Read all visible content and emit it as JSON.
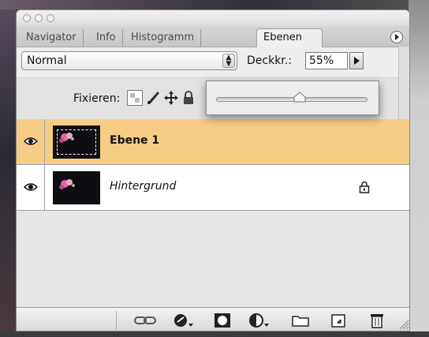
{
  "window": {
    "traffic_lights": [
      "close",
      "minimize",
      "zoom"
    ]
  },
  "tabs": [
    {
      "label": "Navigator",
      "active": false
    },
    {
      "label": "Info",
      "active": false
    },
    {
      "label": "Histogramm",
      "active": false
    },
    {
      "label": "Ebenen",
      "active": true
    }
  ],
  "panel_menu_icon": "panel-menu-arrow-icon",
  "blend_mode": {
    "value": "Normal"
  },
  "opacity": {
    "label": "Deckkr.:",
    "value": "55%"
  },
  "opacity_slider": {
    "value_percent": 55
  },
  "lock": {
    "label": "Fixieren:",
    "icons": [
      "lock-transparent-pixels-icon",
      "lock-image-pixels-icon",
      "lock-position-icon",
      "lock-all-icon"
    ]
  },
  "layers": [
    {
      "name": "Ebene 1",
      "selected": true,
      "visible": true,
      "bold": true,
      "italic": false,
      "locked": false
    },
    {
      "name": "Hintergrund",
      "selected": false,
      "visible": true,
      "bold": false,
      "italic": true,
      "locked": true
    }
  ],
  "footer_buttons": [
    "link-layers-icon",
    "layer-style-icon",
    "layer-mask-icon",
    "adjustment-layer-icon",
    "new-group-icon",
    "new-layer-icon",
    "trash-icon"
  ],
  "colors": {
    "selected_layer": "#f7cd86",
    "panel_bg": "#e8e8e8"
  }
}
